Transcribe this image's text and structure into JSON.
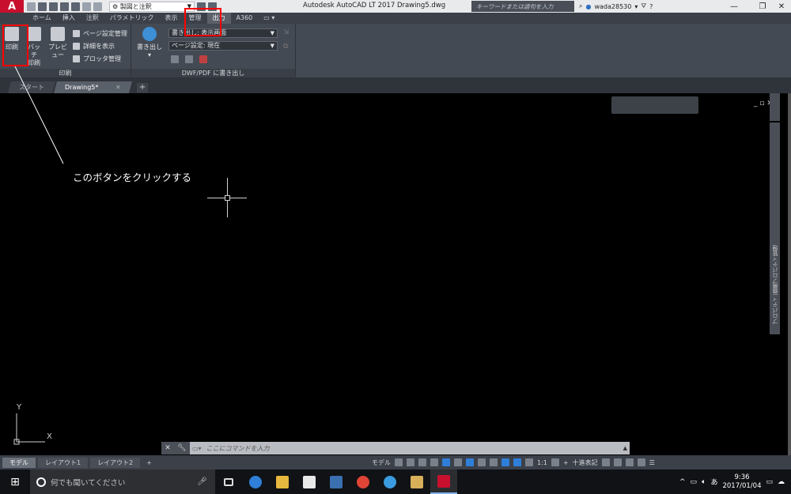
{
  "titlebar": {
    "app_logo": "A",
    "workspace": "製図と注釈",
    "title": "Autodesk AutoCAD LT 2017    Drawing5.dwg",
    "search_placeholder": "キーワードまたは語句を入力",
    "username": "wada28530"
  },
  "tabs": [
    "ホーム",
    "挿入",
    "注釈",
    "パラメトリック",
    "表示",
    "管理",
    "出力",
    "A360"
  ],
  "ribbon": {
    "plot_panel": {
      "title": "印刷",
      "plot_label_1": "印刷",
      "batch_label_1": "バッチ",
      "batch_label_2": "印刷",
      "preview_label": "プレビュー",
      "page_setup": "ページ設定管理",
      "show_details": "詳細を表示",
      "plotter_manager": "プロッタ管理"
    },
    "export_panel": {
      "title": "DWF/PDF に書き出し",
      "export_label": "書き出し",
      "export_mode": "書き出し: 表示画面",
      "page_setting": "ページ設定: 現在"
    }
  },
  "file_tabs": {
    "start": "スタート",
    "drawing": "Drawing5*"
  },
  "annotation": {
    "text": "このボタンをクリックする"
  },
  "ucs": {
    "x": "X",
    "y": "Y"
  },
  "side_panel": {
    "label": "プロパティ 画層プロパティ管理"
  },
  "command": {
    "placeholder": "ここにコマンドを入力"
  },
  "layout_tabs": [
    "モデル",
    "レイアウト1",
    "レイアウト2"
  ],
  "status": {
    "model": "モデル",
    "scale": "1:1",
    "units": "十進表記"
  },
  "taskbar": {
    "search_placeholder": "何でも聞いてください",
    "ime": "あ",
    "time": "9:36",
    "date": "2017/01/04"
  }
}
